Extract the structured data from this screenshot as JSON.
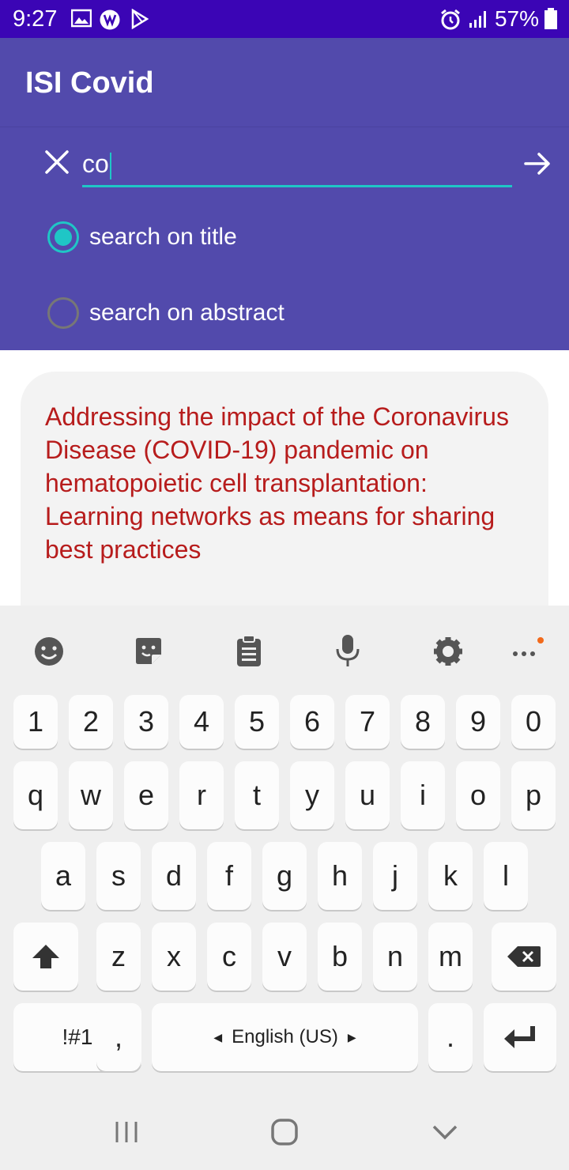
{
  "status_bar": {
    "time": "9:27",
    "battery": "57%"
  },
  "app_bar": {
    "title": "ISI Covid"
  },
  "search": {
    "value": "co",
    "options": [
      {
        "label": "search on title",
        "checked": true
      },
      {
        "label": "search on abstract",
        "checked": false
      }
    ]
  },
  "results": [
    {
      "title": "Addressing the impact of the Coronavirus Disease (COVID-19) pandemic on hematopoietic cell transplantation: Learning networks as means for sharing best practices"
    }
  ],
  "keyboard": {
    "number_row": [
      "1",
      "2",
      "3",
      "4",
      "5",
      "6",
      "7",
      "8",
      "9",
      "0"
    ],
    "row1": [
      "q",
      "w",
      "e",
      "r",
      "t",
      "y",
      "u",
      "i",
      "o",
      "p"
    ],
    "row2": [
      "a",
      "s",
      "d",
      "f",
      "g",
      "h",
      "j",
      "k",
      "l"
    ],
    "row3": [
      "z",
      "x",
      "c",
      "v",
      "b",
      "n",
      "m"
    ],
    "symbols_label": "!#1",
    "comma": ",",
    "space_label": "English (US)",
    "period": "."
  },
  "colors": {
    "status_bar": "#3b05b5",
    "app_bar": "#524aac",
    "accent": "#1fc6c6",
    "result_title": "#b71c1c"
  }
}
